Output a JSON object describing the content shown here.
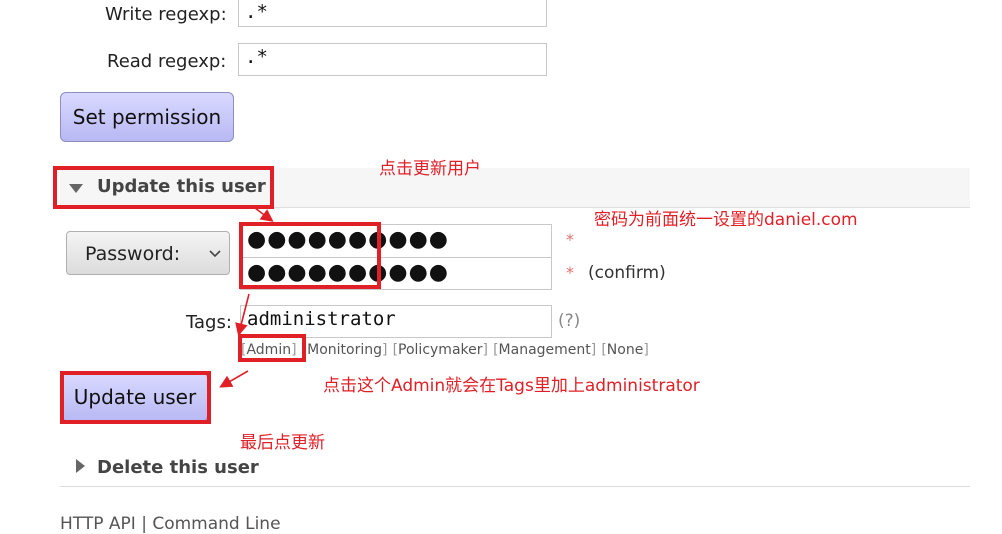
{
  "permissions": {
    "write_label": "Write regexp:",
    "write_value": ".*",
    "read_label": "Read regexp:",
    "read_value": ".*",
    "set_button": "Set permission"
  },
  "update_section": {
    "title": "Update this user",
    "password_select": "Password:",
    "password_value": "●●●●●●●●●●",
    "password_confirm_value": "●●●●●●●●●●",
    "required_mark": "*",
    "confirm_label": "(confirm)",
    "tags_label": "Tags:",
    "tags_value": "administrator",
    "tags_help": "(?)",
    "tag_options": [
      "Admin",
      "Monitoring",
      "Policymaker",
      "Management",
      "None"
    ],
    "update_button": "Update user"
  },
  "delete_section": {
    "title": "Delete this user"
  },
  "footer": {
    "partial_text": "HTTP API | Command Line"
  },
  "annotations": {
    "click_update": "点击更新用户",
    "password_note": "密码为前面统一设置的daniel.com",
    "admin_note": "点击这个Admin就会在Tags里加上administrator",
    "final_note": "最后点更新"
  }
}
